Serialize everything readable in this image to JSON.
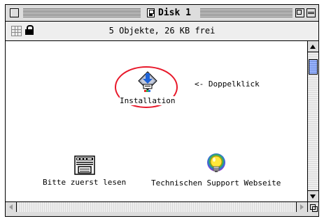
{
  "window": {
    "title": "Disk 1",
    "info": "5 Objekte, 26 KB frei"
  },
  "items": [
    {
      "label": "Installation",
      "icon": "installer-icon"
    },
    {
      "label": "Bitte zuerst lesen",
      "icon": "document-icon"
    },
    {
      "label": "Technischen Support Webseite",
      "icon": "lightbulb-icon"
    }
  ],
  "hint": "<- Doppelklick",
  "colors": {
    "highlight_circle": "#e8182a",
    "scroll_thumb": "#9db7ff",
    "chrome": "#dddddd"
  }
}
